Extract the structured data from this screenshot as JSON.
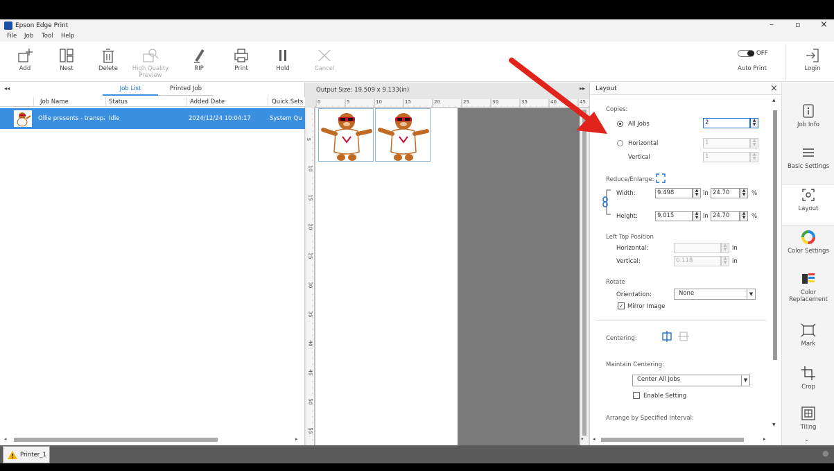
{
  "window": {
    "title": "Epson Edge Print"
  },
  "menu": [
    "File",
    "Job",
    "Tool",
    "Help"
  ],
  "toolbar": {
    "add": "Add",
    "nest": "Nest",
    "delete": "Delete",
    "hq_preview_1": "High Quality",
    "hq_preview_2": "Preview",
    "rip": "RIP",
    "print": "Print",
    "hold": "Hold",
    "cancel": "Cancel",
    "auto_print_state": "OFF",
    "auto_print": "Auto Print",
    "login": "Login"
  },
  "jobs": {
    "tabs": [
      "Job List",
      "Printed Job"
    ],
    "columns": [
      "Job Name",
      "Status",
      "Added Date",
      "Quick Sets"
    ],
    "rows": [
      {
        "name": "Ollie presents - transpa",
        "status": "Idle",
        "date": "2024/12/24 10:04:17",
        "quickset": "System Qu"
      }
    ]
  },
  "preview": {
    "output_size": "Output Size:  19.509 x 9.133(in)",
    "ruler_top": [
      "0",
      "5",
      "10",
      "15",
      "20",
      "25",
      "30",
      "35",
      "40",
      "45"
    ],
    "ruler_left": [
      "5",
      "10",
      "15",
      "20",
      "25",
      "30",
      "35",
      "40",
      "45",
      "50",
      "55"
    ]
  },
  "layout": {
    "title": "Layout",
    "copies": "Copies:",
    "all_jobs": "All Jobs",
    "all_jobs_value": "2",
    "horizontal": "Horizontal",
    "horizontal_value": "1",
    "vertical": "Vertical",
    "vertical_value": "1",
    "reduce_enlarge": "Reduce/Enlarge:",
    "width": "Width:",
    "width_value": "9.498",
    "width_pct": "24.70",
    "height": "Height:",
    "height_value": "9.015",
    "height_pct": "24.70",
    "unit_in": "in",
    "unit_pct": "%",
    "left_top_position": "Left Top Position",
    "pos_horizontal": "Horizontal:",
    "pos_horizontal_value": "",
    "pos_vertical": "Vertical:",
    "pos_vertical_value": "0.118",
    "rotate": "Rotate",
    "orientation": "Orientation:",
    "orientation_value": "None",
    "mirror_image": "Mirror Image",
    "centering": "Centering:",
    "maintain_centering": "Maintain Centering:",
    "maintain_centering_value": "Center All Jobs",
    "enable_setting": "Enable Setting",
    "arrange_interval": "Arrange by Specified Interval:"
  },
  "sidebar": {
    "job_info": "Job Info",
    "basic_settings": "Basic Settings",
    "layout": "Layout",
    "color_settings": "Color Settings",
    "color_replacement_1": "Color",
    "color_replacement_2": "Replacement",
    "mark": "Mark",
    "crop": "Crop",
    "tiling": "Tiling"
  },
  "status": {
    "printer": "Printer_1"
  },
  "colors": {
    "selection": "#3b8fe0",
    "accent": "#1c6fd1",
    "arrow": "#e0241c"
  }
}
